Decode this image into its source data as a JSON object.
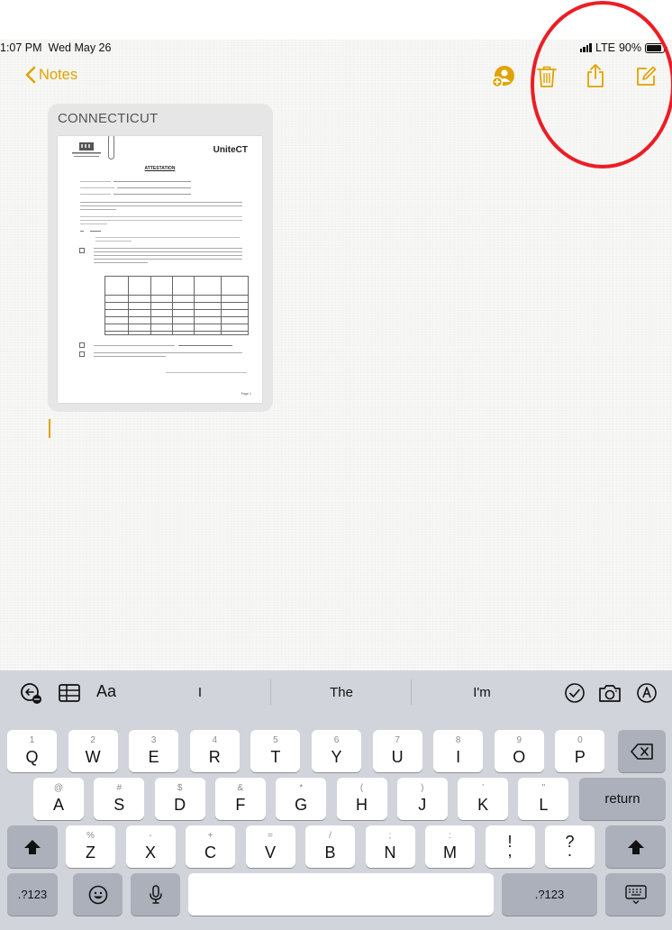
{
  "status_bar": {
    "time": "1:07 PM",
    "date": "Wed May 26",
    "network": "LTE",
    "battery": "90%"
  },
  "nav": {
    "back_label": "Notes"
  },
  "attachment": {
    "title": "CONNECTICUT",
    "doc_brand": "UniteCT",
    "doc_title": "ATTESTATION",
    "doc_page": "Page 1"
  },
  "shortcuts": {
    "format_label": "Aa"
  },
  "suggestions": [
    "I",
    "The",
    "I'm"
  ],
  "keyboard": {
    "row1": [
      {
        "hint": "1",
        "key": "Q"
      },
      {
        "hint": "2",
        "key": "W"
      },
      {
        "hint": "3",
        "key": "E"
      },
      {
        "hint": "4",
        "key": "R"
      },
      {
        "hint": "5",
        "key": "T"
      },
      {
        "hint": "6",
        "key": "Y"
      },
      {
        "hint": "7",
        "key": "U"
      },
      {
        "hint": "8",
        "key": "I"
      },
      {
        "hint": "9",
        "key": "O"
      },
      {
        "hint": "0",
        "key": "P"
      }
    ],
    "row2": [
      {
        "hint": "@",
        "key": "A"
      },
      {
        "hint": "#",
        "key": "S"
      },
      {
        "hint": "$",
        "key": "D"
      },
      {
        "hint": "&",
        "key": "F"
      },
      {
        "hint": "*",
        "key": "G"
      },
      {
        "hint": "(",
        "key": "H"
      },
      {
        "hint": ")",
        "key": "J"
      },
      {
        "hint": "’",
        "key": "K"
      },
      {
        "hint": "\"",
        "key": "L"
      }
    ],
    "row3": [
      {
        "hint": "%",
        "key": "Z"
      },
      {
        "hint": "-",
        "key": "X"
      },
      {
        "hint": "+",
        "key": "C"
      },
      {
        "hint": "=",
        "key": "V"
      },
      {
        "hint": "/",
        "key": "B"
      },
      {
        "hint": ";",
        "key": "N"
      },
      {
        "hint": ":",
        "key": "M"
      },
      {
        "hint": "",
        "key": "!\n,"
      },
      {
        "hint": "",
        "key": "?\n."
      }
    ],
    "return_label": "return",
    "numbers_label": ".?123"
  },
  "colors": {
    "accent": "#e0a300",
    "annotation": "#ec1d24",
    "keyboard_bg": "#d1d4da"
  }
}
